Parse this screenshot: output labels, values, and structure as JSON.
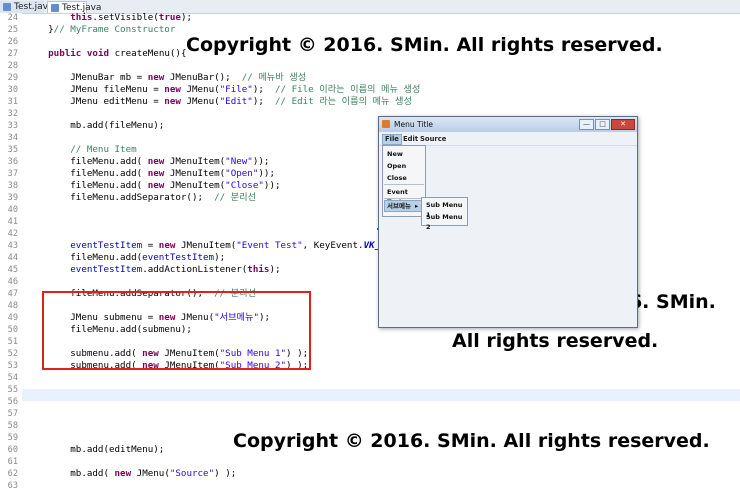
{
  "tabs": [
    {
      "label": "Test.java"
    },
    {
      "label": "Test.java"
    }
  ],
  "editor": {
    "line_numbers": [
      "24",
      "25",
      "26",
      "27",
      "28",
      "29",
      "30",
      "31",
      "32",
      "33",
      "34",
      "35",
      "36",
      "37",
      "38",
      "39",
      "40",
      "41",
      "42",
      "43",
      "44",
      "45",
      "46",
      "47",
      "48",
      "49",
      "50",
      "51",
      "52",
      "53",
      "54",
      "55",
      "56",
      "57",
      "58",
      "59",
      "60",
      "61",
      "62",
      "63"
    ],
    "lines": [
      [
        {
          "t": "        "
        },
        {
          "t": "this",
          "c": "kw"
        },
        {
          "t": ".setVisible("
        },
        {
          "t": "true",
          "c": "kw"
        },
        {
          "t": ");"
        }
      ],
      [
        {
          "t": "    }"
        },
        {
          "t": "// MyFrame Constructor",
          "c": "cm"
        }
      ],
      [],
      [
        {
          "t": "    "
        },
        {
          "t": "public",
          "c": "kw"
        },
        {
          "t": " "
        },
        {
          "t": "void",
          "c": "kw"
        },
        {
          "t": " createMenu(){"
        }
      ],
      [],
      [
        {
          "t": "        JMenuBar mb = "
        },
        {
          "t": "new",
          "c": "kw"
        },
        {
          "t": " JMenuBar();  "
        },
        {
          "t": "// 메뉴바 생성",
          "c": "cm"
        }
      ],
      [
        {
          "t": "        JMenu fileMenu = "
        },
        {
          "t": "new",
          "c": "kw"
        },
        {
          "t": " JMenu("
        },
        {
          "t": "\"File\"",
          "c": "str"
        },
        {
          "t": ");  "
        },
        {
          "t": "// File 이라는 이름의 메뉴 생성",
          "c": "cm"
        }
      ],
      [
        {
          "t": "        JMenu editMenu = "
        },
        {
          "t": "new",
          "c": "kw"
        },
        {
          "t": " JMenu("
        },
        {
          "t": "\"Edit\"",
          "c": "str"
        },
        {
          "t": ");  "
        },
        {
          "t": "// Edit 라는 이름의 메뉴 생성",
          "c": "cm"
        }
      ],
      [],
      [
        {
          "t": "        mb.add(fileMenu);"
        }
      ],
      [],
      [
        {
          "t": "        "
        },
        {
          "t": "// Menu Item",
          "c": "cm"
        }
      ],
      [
        {
          "t": "        fileMenu.add( "
        },
        {
          "t": "new",
          "c": "kw"
        },
        {
          "t": " JMenuItem("
        },
        {
          "t": "\"New\"",
          "c": "str"
        },
        {
          "t": "));"
        }
      ],
      [
        {
          "t": "        fileMenu.add( "
        },
        {
          "t": "new",
          "c": "kw"
        },
        {
          "t": " JMenuItem("
        },
        {
          "t": "\"Open\"",
          "c": "str"
        },
        {
          "t": "));"
        }
      ],
      [
        {
          "t": "        fileMenu.add( "
        },
        {
          "t": "new",
          "c": "kw"
        },
        {
          "t": " JMenuItem("
        },
        {
          "t": "\"Close\"",
          "c": "str"
        },
        {
          "t": "));"
        }
      ],
      [
        {
          "t": "        fileMenu.addSeparator();  "
        },
        {
          "t": "// 분리선",
          "c": "cm"
        }
      ],
      [],
      [],
      [],
      [
        {
          "t": "        "
        },
        {
          "t": "eventTestItem",
          "c": "fld"
        },
        {
          "t": " = "
        },
        {
          "t": "new",
          "c": "kw"
        },
        {
          "t": " JMenuItem("
        },
        {
          "t": "\"Event Test\"",
          "c": "str"
        },
        {
          "t": ", KeyEvent."
        },
        {
          "t": "VK_E",
          "c": "kc"
        },
        {
          "t": ");"
        }
      ],
      [
        {
          "t": "        fileMenu.add("
        },
        {
          "t": "eventTestItem",
          "c": "fld"
        },
        {
          "t": ");"
        }
      ],
      [
        {
          "t": "        "
        },
        {
          "t": "eventTestItem",
          "c": "fld"
        },
        {
          "t": ".addActionListener("
        },
        {
          "t": "this",
          "c": "kw"
        },
        {
          "t": ");"
        }
      ],
      [],
      [
        {
          "t": "        fileMenu.addSeparator();  "
        },
        {
          "t": "// 분리선",
          "c": "cm"
        }
      ],
      [],
      [
        {
          "t": "        JMenu submenu = "
        },
        {
          "t": "new",
          "c": "kw"
        },
        {
          "t": " JMenu("
        },
        {
          "t": "\"서브메뉴\"",
          "c": "str"
        },
        {
          "t": ");"
        }
      ],
      [
        {
          "t": "        fileMenu.add(submenu);"
        }
      ],
      [],
      [
        {
          "t": "        submenu.add( "
        },
        {
          "t": "new",
          "c": "kw"
        },
        {
          "t": " JMenuItem("
        },
        {
          "t": "\"Sub Menu 1\"",
          "c": "str"
        },
        {
          "t": ") );"
        }
      ],
      [
        {
          "t": "        submenu.add( "
        },
        {
          "t": "new",
          "c": "kw"
        },
        {
          "t": " JMenuItem("
        },
        {
          "t": "\"Sub Menu 2\"",
          "c": "str"
        },
        {
          "t": ") );"
        }
      ],
      [],
      [],
      [],
      [],
      [],
      [],
      [
        {
          "t": "        mb.add(editMenu);"
        }
      ],
      [],
      [
        {
          "t": "        mb.add( "
        },
        {
          "t": "new",
          "c": "kw"
        },
        {
          "t": " JMenu("
        },
        {
          "t": "\"Source\"",
          "c": "str"
        },
        {
          "t": ") );"
        }
      ],
      []
    ]
  },
  "window": {
    "title": "Menu Title",
    "buttons": {
      "minimize": "—",
      "maximize": "□",
      "close": "✕"
    },
    "menubar": [
      "File",
      "Edit",
      "Source"
    ],
    "file_menu_items": [
      "New",
      "Open",
      "Close",
      "Event Test",
      "서브메뉴"
    ],
    "submenu_arrow": "▸",
    "submenu_items": [
      "Sub Menu 1",
      "Sub Menu 2"
    ]
  },
  "watermarks": [
    "Copyright © 2016. SMin. All rights reserved.",
    "Copyright © 2016. SMin.",
    "All rights reserved.",
    "Copyright © 2016. SMin. All rights reserved."
  ],
  "colors": {
    "highlight_box": "#e0201b",
    "keyword": "#7f0055",
    "string": "#2a00ff",
    "comment": "#3f7f5f"
  }
}
